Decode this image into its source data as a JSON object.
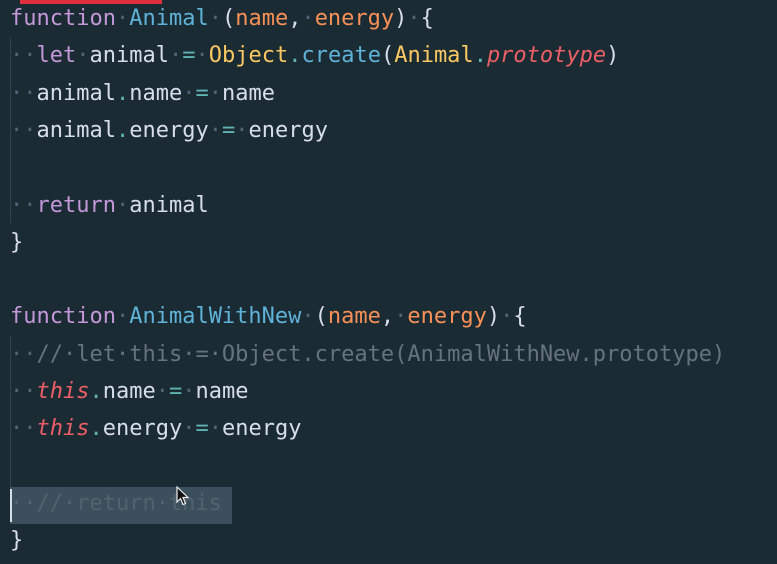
{
  "code": {
    "lines": [
      {
        "tokens": [
          {
            "t": "function",
            "c": "kw"
          },
          {
            "t": "·",
            "c": "ws"
          },
          {
            "t": "Animal",
            "c": "fn"
          },
          {
            "t": "·",
            "c": "ws"
          },
          {
            "t": "(",
            "c": "punct"
          },
          {
            "t": "name",
            "c": "param"
          },
          {
            "t": ",",
            "c": "punct"
          },
          {
            "t": "·",
            "c": "ws"
          },
          {
            "t": "energy",
            "c": "param"
          },
          {
            "t": ")",
            "c": "punct"
          },
          {
            "t": "·",
            "c": "ws"
          },
          {
            "t": "{",
            "c": "punct"
          }
        ]
      },
      {
        "tokens": [
          {
            "t": "··",
            "c": "ws"
          },
          {
            "t": "let",
            "c": "kw"
          },
          {
            "t": "·",
            "c": "ws"
          },
          {
            "t": "animal",
            "c": "plain"
          },
          {
            "t": "·",
            "c": "ws"
          },
          {
            "t": "=",
            "c": "op"
          },
          {
            "t": "·",
            "c": "ws"
          },
          {
            "t": "Object",
            "c": "cls"
          },
          {
            "t": ".",
            "c": "op"
          },
          {
            "t": "create",
            "c": "fn"
          },
          {
            "t": "(",
            "c": "punct"
          },
          {
            "t": "Animal",
            "c": "cls"
          },
          {
            "t": ".",
            "c": "op"
          },
          {
            "t": "prototype",
            "c": "proto"
          },
          {
            "t": ")",
            "c": "punct"
          }
        ]
      },
      {
        "tokens": [
          {
            "t": "··",
            "c": "ws"
          },
          {
            "t": "animal",
            "c": "plain"
          },
          {
            "t": ".",
            "c": "op"
          },
          {
            "t": "name",
            "c": "plain"
          },
          {
            "t": "·",
            "c": "ws"
          },
          {
            "t": "=",
            "c": "op"
          },
          {
            "t": "·",
            "c": "ws"
          },
          {
            "t": "name",
            "c": "plain"
          }
        ]
      },
      {
        "tokens": [
          {
            "t": "··",
            "c": "ws"
          },
          {
            "t": "animal",
            "c": "plain"
          },
          {
            "t": ".",
            "c": "op"
          },
          {
            "t": "energy",
            "c": "plain"
          },
          {
            "t": "·",
            "c": "ws"
          },
          {
            "t": "=",
            "c": "op"
          },
          {
            "t": "·",
            "c": "ws"
          },
          {
            "t": "energy",
            "c": "plain"
          }
        ]
      },
      {
        "tokens": []
      },
      {
        "tokens": [
          {
            "t": "··",
            "c": "ws"
          },
          {
            "t": "return",
            "c": "kw"
          },
          {
            "t": "·",
            "c": "ws"
          },
          {
            "t": "animal",
            "c": "plain"
          }
        ]
      },
      {
        "tokens": [
          {
            "t": "}",
            "c": "punct"
          }
        ]
      },
      {
        "tokens": []
      },
      {
        "tokens": [
          {
            "t": "function",
            "c": "kw"
          },
          {
            "t": "·",
            "c": "ws"
          },
          {
            "t": "AnimalWithNew",
            "c": "fn"
          },
          {
            "t": "·",
            "c": "ws"
          },
          {
            "t": "(",
            "c": "punct"
          },
          {
            "t": "name",
            "c": "param"
          },
          {
            "t": ",",
            "c": "punct"
          },
          {
            "t": "·",
            "c": "ws"
          },
          {
            "t": "energy",
            "c": "param"
          },
          {
            "t": ")",
            "c": "punct"
          },
          {
            "t": "·",
            "c": "ws"
          },
          {
            "t": "{",
            "c": "punct"
          }
        ]
      },
      {
        "tokens": [
          {
            "t": "··",
            "c": "ws"
          },
          {
            "t": "//·let·this·=·Object.create(AnimalWithNew.prototype)",
            "c": "comment"
          }
        ]
      },
      {
        "tokens": [
          {
            "t": "··",
            "c": "ws"
          },
          {
            "t": "this",
            "c": "thiskw"
          },
          {
            "t": ".",
            "c": "op"
          },
          {
            "t": "name",
            "c": "plain"
          },
          {
            "t": "·",
            "c": "ws"
          },
          {
            "t": "=",
            "c": "op"
          },
          {
            "t": "·",
            "c": "ws"
          },
          {
            "t": "name",
            "c": "plain"
          }
        ]
      },
      {
        "tokens": [
          {
            "t": "··",
            "c": "ws"
          },
          {
            "t": "this",
            "c": "thiskw"
          },
          {
            "t": ".",
            "c": "op"
          },
          {
            "t": "energy",
            "c": "plain"
          },
          {
            "t": "·",
            "c": "ws"
          },
          {
            "t": "=",
            "c": "op"
          },
          {
            "t": "·",
            "c": "ws"
          },
          {
            "t": "energy",
            "c": "plain"
          }
        ]
      },
      {
        "tokens": []
      },
      {
        "tokens": [
          {
            "t": "··//·return·this",
            "c": "comment-dim"
          }
        ]
      },
      {
        "tokens": [
          {
            "t": "}",
            "c": "punct"
          }
        ]
      }
    ]
  },
  "colors": {
    "background": "#1b2b34",
    "keyword": "#c397d8",
    "function": "#5fb3d8",
    "parameter": "#f99157",
    "class": "#fac863",
    "this": "#ec5f67",
    "operator": "#5fb3b3",
    "comment": "#65737e",
    "selection": "#3b4f5c"
  },
  "icons": {
    "pointer": "mouse-pointer-icon"
  }
}
